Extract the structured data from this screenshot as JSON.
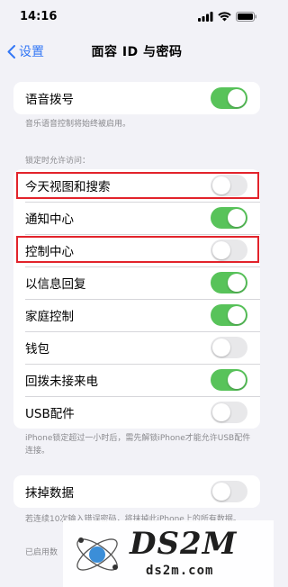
{
  "status_bar": {
    "time": "14:16"
  },
  "nav": {
    "back_label": "设置",
    "title": "面容 ID 与密码"
  },
  "voice_dial": {
    "label": "语音拨号",
    "toggle_on": true
  },
  "voice_dial_note": "音乐语音控制将始终被启用。",
  "lock_section_header": "锁定时允许访问：",
  "lock_items": [
    {
      "label": "今天视图和搜索",
      "toggle_on": false
    },
    {
      "label": "通知中心",
      "toggle_on": true
    },
    {
      "label": "控制中心",
      "toggle_on": false
    },
    {
      "label": "以信息回复",
      "toggle_on": true
    },
    {
      "label": "家庭控制",
      "toggle_on": true
    },
    {
      "label": "钱包",
      "toggle_on": false
    },
    {
      "label": "回拨未接来电",
      "toggle_on": true
    },
    {
      "label": "USB配件",
      "toggle_on": false
    }
  ],
  "usb_note": "iPhone锁定超过一小时后，需先解锁iPhone才能允许USB配件连接。",
  "erase": {
    "label": "抹掉数据",
    "toggle_on": false
  },
  "erase_note": "若连续10次输入错误密码，将抹掉此iPhone上的所有数据。",
  "enabled_note": "已启用数",
  "watermark": {
    "logo_text": "DS2M",
    "sub_text": "ds2m.com"
  },
  "colors": {
    "accent": "#3478f6",
    "toggle_on": "#58c35a",
    "highlight": "#e2232b"
  }
}
